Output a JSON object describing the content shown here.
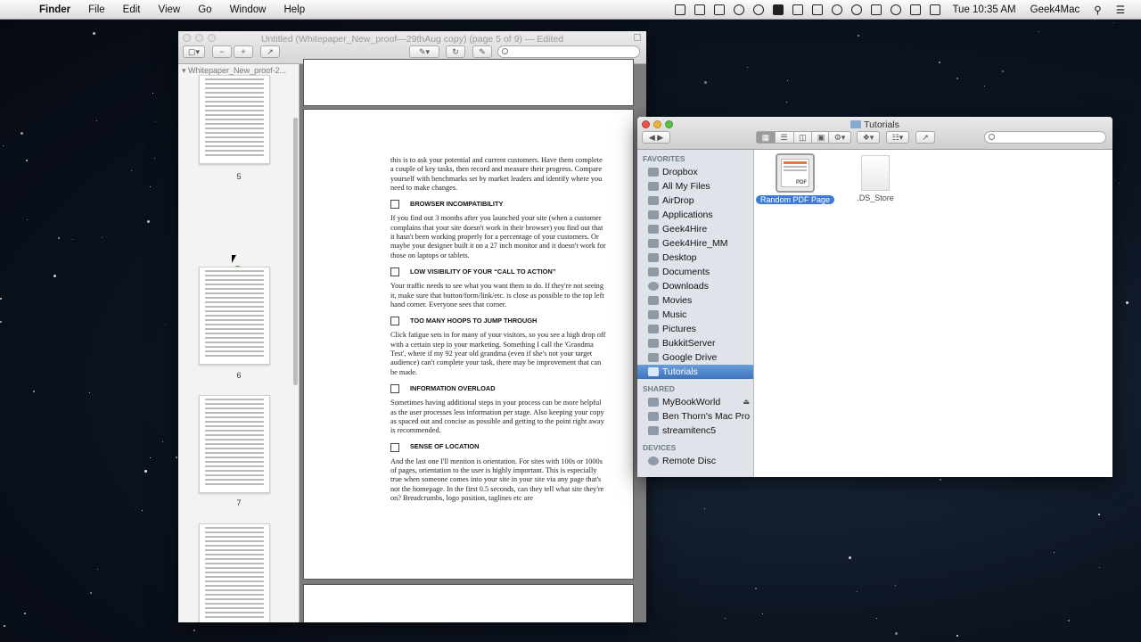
{
  "menubar": {
    "apple": "",
    "items": [
      "Finder",
      "File",
      "Edit",
      "View",
      "Go",
      "Window",
      "Help"
    ],
    "clock": "Tue 10:35 AM",
    "user": "Geek4Mac"
  },
  "preview": {
    "title": "Untitled (Whitepaper_New_proof—29thAug copy) (page 5 of 9) — Edited",
    "sidebar_heading": "Whitepaper_New_proof-2...",
    "page_numbers": [
      "5",
      "6",
      "7"
    ],
    "document": {
      "intro": "this is to ask your potential and current customers. Have them complete a couple of key tasks, then record and measure their progress. Compare yourself with benchmarks set by market leaders and identify where you need to make changes.",
      "sections": [
        {
          "heading": "BROWSER INCOMPATIBILITY",
          "body": "If you find out 3 months after you launched your site (when a customer complains that your site doesn't work in their browser) you find out that it hasn't been working properly for a percentage of your customers. Or maybe your designer built it on a 27 inch monitor and it doesn't work for those on laptops or tablets."
        },
        {
          "heading": "LOW VISIBILITY OF YOUR “CALL TO ACTION”",
          "body": "Your traffic needs to see what you want them to do. If they're not seeing it, make sure that button/form/link/etc. is close as possible to the top left hand corner. Everyone sees that corner."
        },
        {
          "heading": "TOO MANY HOOPS TO JUMP THROUGH",
          "body": "Click fatigue sets in for many of your visitors, so you see a high drop off with a certain step in your marketing. Something I call the 'Grandma Test', where if my 92 year old grandma (even if she's not your target audience) can't complete your task, there may be improvement that can be made."
        },
        {
          "heading": "INFORMATION OVERLOAD",
          "body": "Sometimes having additional steps in your process can be more helpful as the user processes less information per stage. Also keeping your copy as spaced out and concise as possible and getting to the point right away is recommended."
        },
        {
          "heading": "SENSE OF LOCATION",
          "body": "And the last one I'll mention is orientation. For sites with 100s or 1000s of pages, orientation to the user is highly important. This is especially true when someone comes into your site in your site via any page that's not the homepage. In the first 0.5 seconds, can they tell what site they're on? Breadcrumbs, logo position, taglines etc are"
        }
      ]
    }
  },
  "finder": {
    "title": "Tutorials",
    "groups": [
      {
        "label": "FAVORITES",
        "items": [
          "Dropbox",
          "All My Files",
          "AirDrop",
          "Applications",
          "Geek4Hire",
          "Geek4Hire_MM",
          "Desktop",
          "Documents",
          "Downloads",
          "Movies",
          "Music",
          "Pictures",
          "BukkitServer",
          "Google Drive",
          "Tutorials"
        ]
      },
      {
        "label": "SHARED",
        "items": [
          "MyBookWorld",
          "Ben Thorn's Mac Pro",
          "streamitenc5"
        ]
      },
      {
        "label": "DEVICES",
        "items": [
          "Remote Disc"
        ]
      }
    ],
    "selected_item": "Tutorials",
    "files": [
      {
        "name": "Random PDF Page",
        "selected": true,
        "badge": "PDF"
      },
      {
        "name": ".DS_Store",
        "selected": false
      }
    ]
  },
  "colors": {
    "selection": "#3d7bd6",
    "sidebar_bg": "#dfe4ea"
  }
}
